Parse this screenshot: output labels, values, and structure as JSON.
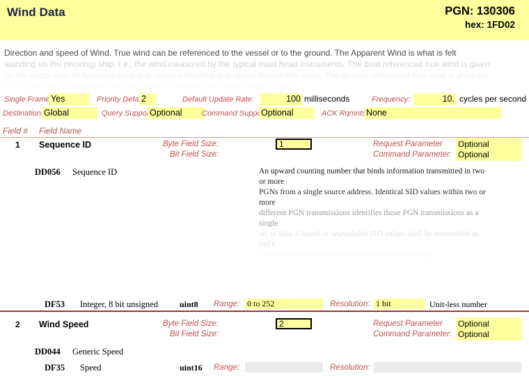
{
  "header": {
    "title": "Wind Data",
    "pgn_label": "PGN: 130306",
    "hex_label": "hex: 1FD02"
  },
  "description": {
    "line1": "Direction and speed of Wind.  True wind can be referenced to the vessel or to the ground.  The Apparent Wind is what is felt",
    "line2": "standing on the (moving) ship, I.e., the wind measured by the typical mast head instruments. The boat referenced true wind is given",
    "line3": "by the vector sum of Apparent wind and vessel's heading and speed though the water. The ground referenced true wind is given by",
    "line4": "the vector sum of Apparent wind and vessel's heading and speed over ground."
  },
  "meta": {
    "single_frame_label": "Single Frame:",
    "single_frame_value": "Yes",
    "priority_default_label": "Priority Default:",
    "priority_default_value": "2",
    "default_update_rate_label": "Default Update Rate:",
    "default_update_rate_value": "100",
    "default_update_rate_units": "milliseconds",
    "frequency_label": "Frequency:",
    "frequency_value": "10.",
    "frequency_units": "cycles per second",
    "destination_label": "Destination:",
    "destination_value": "Global",
    "query_support_label": "Query Support:",
    "query_support_value": "Optional",
    "command_support_label": "Command Support:",
    "command_support_value": "Optional",
    "ack_rqmnts_label": "ACK Rqmnts:",
    "ack_rqmnts_value": "None"
  },
  "table_header": {
    "field_num": "Field #",
    "field_name": "Field Name"
  },
  "fields": [
    {
      "num": "1",
      "name": "Sequence ID",
      "byte_field_size_label": "Byte Field Size:",
      "byte_field_size_value": "1",
      "bit_field_size_label": "Bit Field Size:",
      "bit_field_size_value": "",
      "request_parameter_label": "Request Parameter",
      "request_parameter_value": "Optional",
      "command_parameter_label": "Command Parameter:",
      "command_parameter_value": "Optional",
      "dd_code": "DD056",
      "dd_name": "Sequence ID",
      "dd_desc_line1": "An upward counting number that binds information transmitted in two or more",
      "dd_desc_line2": "PGNs from a single source address. Identical SID values within two or more",
      "dd_desc_line3": "different PGN transmissions identifies those PGN transmissions as a single",
      "dd_desc_line4": "set of data. Unused or unavailable SID values shall be transmitted as 0xFF.",
      "dd_desc_line5": "The SID value is incremented for each new set of data.",
      "df_code": "DF53",
      "df_name": "Integer, 8 bit unsigned",
      "df_type": "uint8",
      "range_label": "Range:",
      "range_value": "0 to 252",
      "resolution_label": "Resolution:",
      "resolution_value": "1 bit",
      "units_note": "Unit-less number"
    },
    {
      "num": "2",
      "name": "Wind Speed",
      "byte_field_size_label": "Byte Field Size:",
      "byte_field_size_value": "2",
      "bit_field_size_label": "Bit Field Size:",
      "bit_field_size_value": "",
      "request_parameter_label": "Request Parameter",
      "request_parameter_value": "Optional",
      "command_parameter_label": "Command Parameter:",
      "command_parameter_value": "Optional",
      "dd_code": "DD044",
      "dd_name": "Generic Speed",
      "df_code": "DF35",
      "df_name": "Speed",
      "df_type": "uint16",
      "range_label": "Range:",
      "range_value": "",
      "resolution_label": "Resolution:",
      "resolution_value": ""
    }
  ],
  "colors": {
    "highlight": "#ffff9e",
    "label_red": "#c0504d",
    "rule_light": "#d99694",
    "rule_dark": "#963634",
    "title_navy": "#16224a",
    "gray_field": "#ebebeb"
  }
}
